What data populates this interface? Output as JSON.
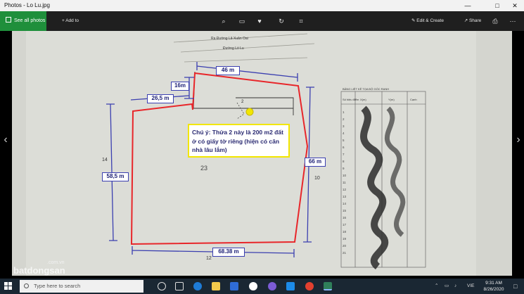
{
  "window": {
    "title": "Photos - Lo Lu.jpg",
    "controls": {
      "minimize": "—",
      "maximize": "□",
      "close": "✕"
    }
  },
  "toolbar": {
    "see_all_label": "See all photos",
    "add_to_label": "Add to",
    "zoom_icon": "zoom-icon",
    "slideshow_icon": "slideshow-icon",
    "delete_icon": "delete-icon",
    "favorite_icon": "favorite-icon",
    "rotate_icon": "rotate-icon",
    "crop_icon": "crop-icon",
    "edit_create_label": "Edit & Create",
    "share_label": "Share",
    "print_icon": "print-icon",
    "more_icon": "more-icon"
  },
  "photo": {
    "note_text": "Chú ý: Thửa 2 này là 200 m2 đất ở có giấy tờ riêng (hiện có căn nhà lâu lắm)",
    "labels": {
      "top_width": "46 m",
      "notch_height": "16m",
      "notch_width": "26,5 m",
      "left_height": "58,5 m",
      "right_height": "66 m",
      "bottom_width": "68.38 m"
    },
    "plan_text": {
      "road_1": "Ra Đường Lã Xuân Oai",
      "road_2": "Đường Lò Lu",
      "parcel": "23",
      "lot_no": "2",
      "right_no": "10",
      "left_no": "14",
      "bottom_no": "12",
      "table_title": "BẢNG LIỆT KÊ TỌA ĐỘ GÓC RANH",
      "table_header": [
        "Số hiệu điểm",
        "X(m)",
        "Y(m)",
        "Cạnh"
      ]
    },
    "colors": {
      "boundary": "#e8262a",
      "dimension": "#3b3fb0",
      "note_border": "#f2e600"
    }
  },
  "watermark": {
    "small": ".com.vn",
    "big": "batdongsan"
  },
  "taskbar": {
    "search_placeholder": "Type here to search",
    "language": "VIE",
    "time": "9:31 AM",
    "date": "8/26/2020"
  }
}
